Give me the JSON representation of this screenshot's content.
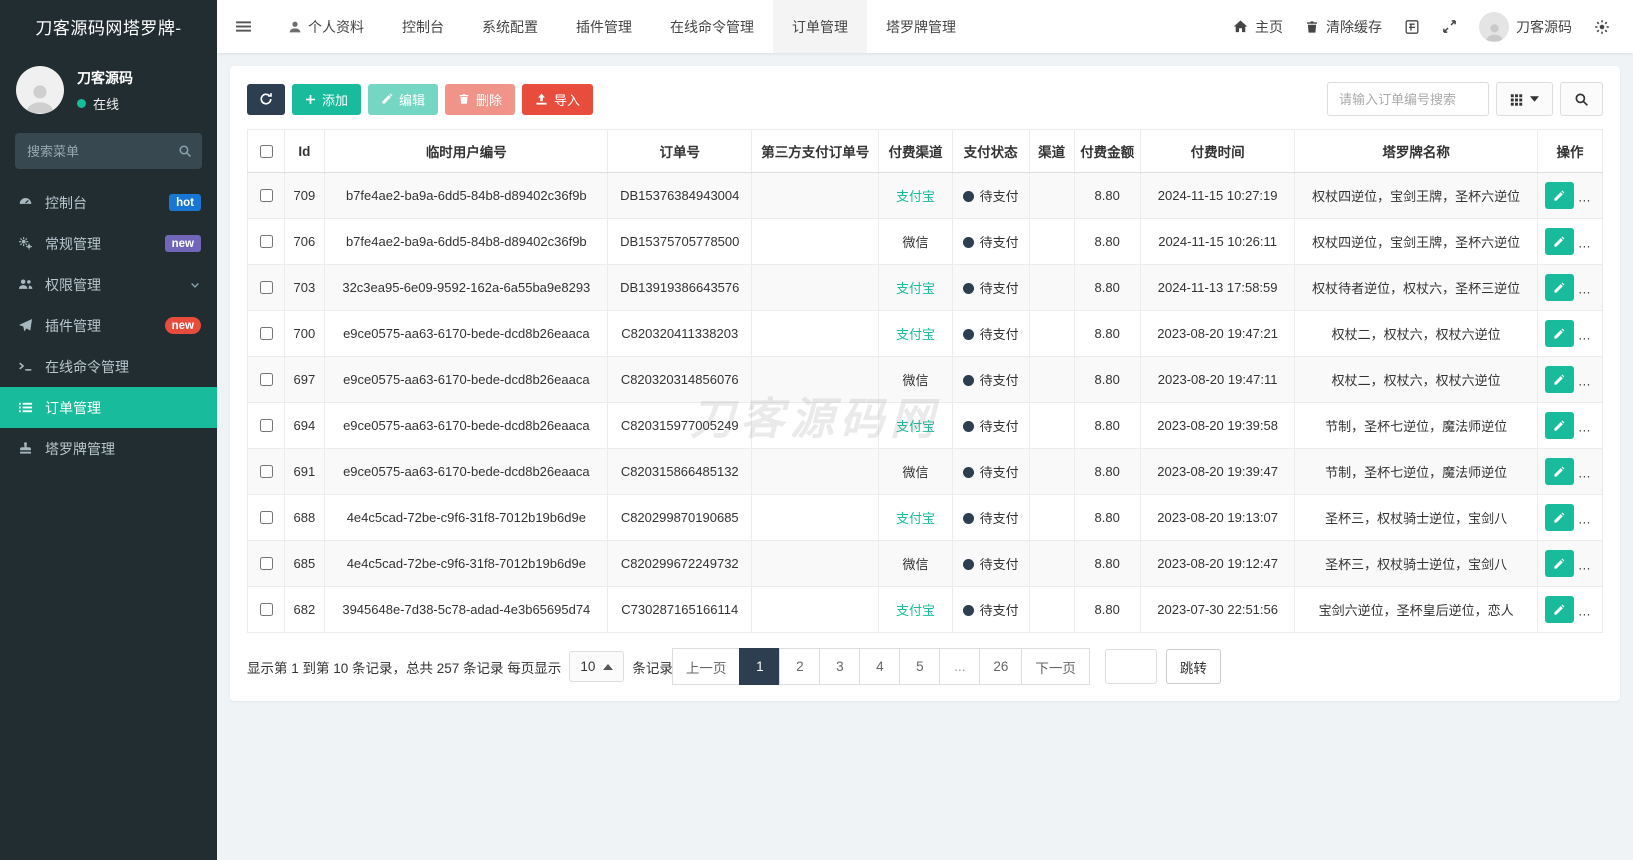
{
  "sidebar": {
    "brand": "刀客源码网塔罗牌-",
    "user": {
      "name": "刀客源码",
      "status": "在线"
    },
    "search_placeholder": "搜索菜单",
    "items": [
      {
        "key": "console",
        "label": "控制台",
        "icon": "dashboard-icon",
        "badge": "hot",
        "badge_style": "blue"
      },
      {
        "key": "general",
        "label": "常规管理",
        "icon": "gears-icon",
        "badge": "new",
        "badge_style": "purple"
      },
      {
        "key": "auth",
        "label": "权限管理",
        "icon": "users-icon",
        "chevron": true
      },
      {
        "key": "addon",
        "label": "插件管理",
        "icon": "rocket-icon",
        "badge": "new",
        "badge_style": "red-pill"
      },
      {
        "key": "command",
        "label": "在线命令管理",
        "icon": "terminal-icon"
      },
      {
        "key": "order",
        "label": "订单管理",
        "icon": "list-icon",
        "active": true
      },
      {
        "key": "tarot",
        "label": "塔罗牌管理",
        "icon": "stamp-icon"
      }
    ]
  },
  "topbar": {
    "tabs": [
      {
        "key": "profile",
        "label": "个人资料",
        "icon": "user-icon"
      },
      {
        "key": "dashboard",
        "label": "控制台"
      },
      {
        "key": "config",
        "label": "系统配置"
      },
      {
        "key": "addon",
        "label": "插件管理"
      },
      {
        "key": "command",
        "label": "在线命令管理"
      },
      {
        "key": "order",
        "label": "订单管理",
        "active": true
      },
      {
        "key": "tarot",
        "label": "塔罗牌管理"
      }
    ],
    "right": {
      "home": "主页",
      "clear_cache": "清除缓存",
      "username": "刀客源码"
    }
  },
  "toolbar": {
    "add": "添加",
    "edit": "编辑",
    "delete": "删除",
    "import": "导入",
    "search_placeholder": "请输入订单编号搜索"
  },
  "table": {
    "columns": [
      "Id",
      "临时用户编号",
      "订单号",
      "第三方支付订单号",
      "付费渠道",
      "支付状态",
      "渠道",
      "付费金额",
      "付费时间",
      "塔罗牌名称",
      "操作"
    ],
    "status_pending": "待支付",
    "rows": [
      {
        "id": "709",
        "user_no": "b7fe4ae2-ba9a-6dd5-84b8-d89402c36f9b",
        "order_no": "DB15376384943004",
        "third_no": "",
        "channel": "支付宝",
        "status": "待支付",
        "qudao": "",
        "amount": "8.80",
        "time": "2024-11-15 10:27:19",
        "tarot": "权杖四逆位，宝剑王牌，圣杯六逆位"
      },
      {
        "id": "706",
        "user_no": "b7fe4ae2-ba9a-6dd5-84b8-d89402c36f9b",
        "order_no": "DB15375705778500",
        "third_no": "",
        "channel": "微信",
        "status": "待支付",
        "qudao": "",
        "amount": "8.80",
        "time": "2024-11-15 10:26:11",
        "tarot": "权杖四逆位，宝剑王牌，圣杯六逆位"
      },
      {
        "id": "703",
        "user_no": "32c3ea95-6e09-9592-162a-6a55ba9e8293",
        "order_no": "DB13919386643576",
        "third_no": "",
        "channel": "支付宝",
        "status": "待支付",
        "qudao": "",
        "amount": "8.80",
        "time": "2024-11-13 17:58:59",
        "tarot": "权杖待者逆位，权杖六，圣杯三逆位"
      },
      {
        "id": "700",
        "user_no": "e9ce0575-aa63-6170-bede-dcd8b26eaaca",
        "order_no": "C820320411338203",
        "third_no": "",
        "channel": "支付宝",
        "status": "待支付",
        "qudao": "",
        "amount": "8.80",
        "time": "2023-08-20 19:47:21",
        "tarot": "权杖二，权杖六，权杖六逆位"
      },
      {
        "id": "697",
        "user_no": "e9ce0575-aa63-6170-bede-dcd8b26eaaca",
        "order_no": "C820320314856076",
        "third_no": "",
        "channel": "微信",
        "status": "待支付",
        "qudao": "",
        "amount": "8.80",
        "time": "2023-08-20 19:47:11",
        "tarot": "权杖二，权杖六，权杖六逆位"
      },
      {
        "id": "694",
        "user_no": "e9ce0575-aa63-6170-bede-dcd8b26eaaca",
        "order_no": "C820315977005249",
        "third_no": "",
        "channel": "支付宝",
        "status": "待支付",
        "qudao": "",
        "amount": "8.80",
        "time": "2023-08-20 19:39:58",
        "tarot": "节制，圣杯七逆位，魔法师逆位"
      },
      {
        "id": "691",
        "user_no": "e9ce0575-aa63-6170-bede-dcd8b26eaaca",
        "order_no": "C820315866485132",
        "third_no": "",
        "channel": "微信",
        "status": "待支付",
        "qudao": "",
        "amount": "8.80",
        "time": "2023-08-20 19:39:47",
        "tarot": "节制，圣杯七逆位，魔法师逆位"
      },
      {
        "id": "688",
        "user_no": "4e4c5cad-72be-c9f6-31f8-7012b19b6d9e",
        "order_no": "C820299870190685",
        "third_no": "",
        "channel": "支付宝",
        "status": "待支付",
        "qudao": "",
        "amount": "8.80",
        "time": "2023-08-20 19:13:07",
        "tarot": "圣杯三，权杖骑士逆位，宝剑八"
      },
      {
        "id": "685",
        "user_no": "4e4c5cad-72be-c9f6-31f8-7012b19b6d9e",
        "order_no": "C820299672249732",
        "third_no": "",
        "channel": "微信",
        "status": "待支付",
        "qudao": "",
        "amount": "8.80",
        "time": "2023-08-20 19:12:47",
        "tarot": "圣杯三，权杖骑士逆位，宝剑八"
      },
      {
        "id": "682",
        "user_no": "3945648e-7d38-5c78-adad-4e3b65695d74",
        "order_no": "C730287165166114",
        "third_no": "",
        "channel": "支付宝",
        "status": "待支付",
        "qudao": "",
        "amount": "8.80",
        "time": "2023-07-30 22:51:56",
        "tarot": "宝剑六逆位，圣杯皇后逆位，恋人"
      }
    ]
  },
  "pagination": {
    "info_prefix": "显示第 1 到第 10 条记录，总共 257 条记录 每页显示",
    "page_size": "10",
    "info_suffix": "条记录",
    "prev": "上一页",
    "next": "下一页",
    "pages": [
      "1",
      "2",
      "3",
      "4",
      "5",
      "...",
      "26"
    ],
    "active_page": "1",
    "jump": "跳转",
    "jump_value": ""
  },
  "watermark": "刀客源码网",
  "colors": {
    "accent_green": "#18bc9c",
    "danger_red": "#e74c3c",
    "dark_navy": "#2c3e50",
    "sidebar_bg": "#222d32",
    "hot_badge_blue": "#1976d2",
    "new_badge_purple": "#7266ba",
    "main_bg": "#eff3f6"
  }
}
